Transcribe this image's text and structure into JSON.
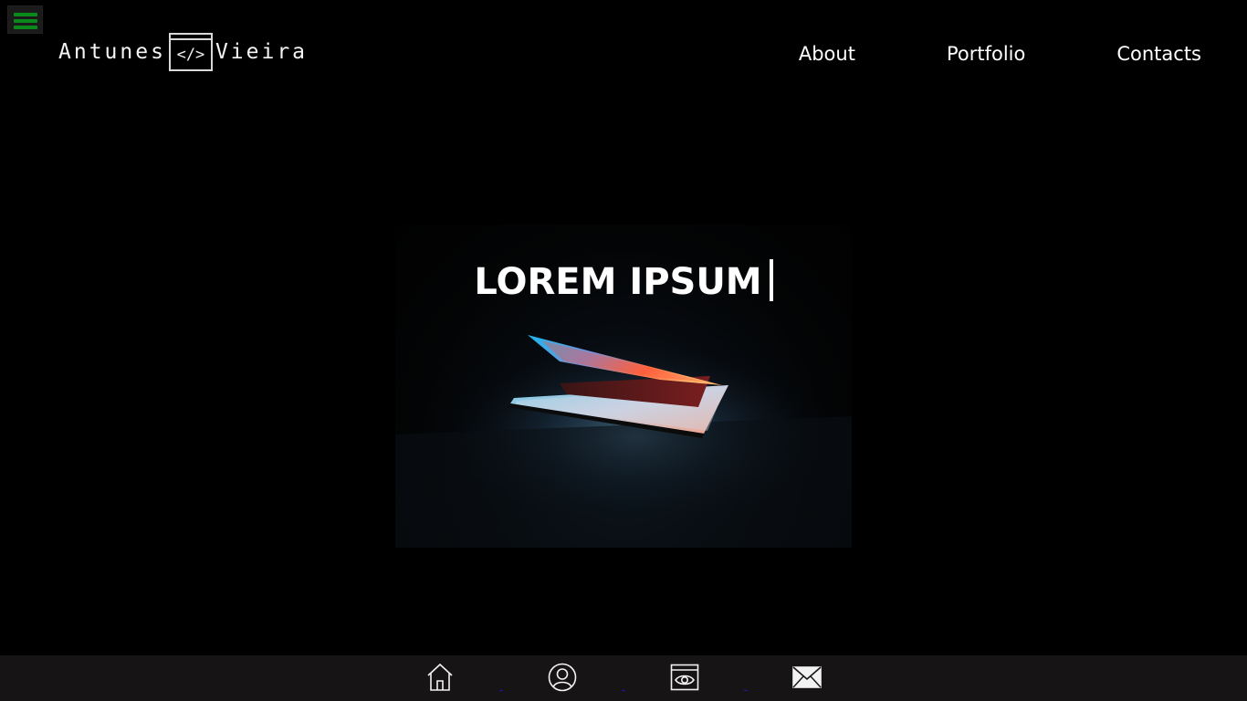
{
  "menu": {
    "icon": "hamburger-icon",
    "color": "#0b8a1c"
  },
  "logo": {
    "left_text": "Antunes",
    "code_text": "</>",
    "right_text": "Vieira"
  },
  "nav": {
    "items": [
      {
        "label": "About"
      },
      {
        "label": "Portfolio"
      },
      {
        "label": "Contacts"
      }
    ]
  },
  "hero": {
    "title": "LOREM IPSUM"
  },
  "bottom_nav": {
    "icons": [
      "home-icon",
      "user-icon",
      "eye-window-icon",
      "mail-icon"
    ]
  }
}
